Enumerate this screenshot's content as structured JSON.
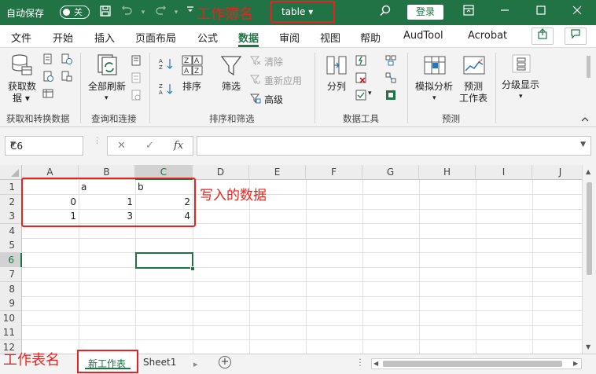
{
  "titlebar": {
    "autosave_label": "自动保存",
    "autosave_state": "关",
    "workbook_name_annotation": "工作簿名",
    "workbook_name": "table ▾",
    "login_label": "登录",
    "icons": [
      "save-icon",
      "undo-icon",
      "redo-icon",
      "customize-icon",
      "search-icon",
      "ribbon-display-icon",
      "minimize-icon",
      "maximize-icon",
      "close-icon"
    ]
  },
  "tabs": {
    "items": [
      "文件",
      "开始",
      "插入",
      "页面布局",
      "公式",
      "数据",
      "审阅",
      "视图",
      "帮助",
      "AudTool",
      "Acrobat"
    ],
    "active": "数据"
  },
  "ribbon": {
    "groups": {
      "get_data": {
        "label": "获取和转换数据",
        "big_label_1": "获取数",
        "big_label_2": "据 ▾"
      },
      "query": {
        "label": "查询和连接",
        "refresh_label_1": "全部刷新",
        "refresh_caret": "▾"
      },
      "sort_filter": {
        "label": "排序和筛选",
        "sort_label": "排序",
        "filter_label": "筛选",
        "clear_label": "清除",
        "reapply_label": "重新应用",
        "advanced_label": "高级"
      },
      "data_tools": {
        "label": "数据工具",
        "split_label": "分列"
      },
      "forecast": {
        "label": "预测",
        "whatif_label_1": "模拟分析",
        "whatif_caret": "▾",
        "forecast_label_1": "预测",
        "forecast_label_2": "工作表"
      },
      "outline": {
        "label": "",
        "outline_label": "分级显示",
        "outline_caret": "▾"
      }
    }
  },
  "formula_bar": {
    "name_box": "C6",
    "cancel_glyph": "✕",
    "enter_glyph": "✓",
    "fx_glyph": "fx",
    "formula": ""
  },
  "grid": {
    "columns": [
      "A",
      "B",
      "C",
      "D",
      "E",
      "F",
      "G",
      "H",
      "I",
      "J"
    ],
    "rows": [
      "1",
      "2",
      "3",
      "4",
      "5",
      "6",
      "7",
      "8",
      "9",
      "10",
      "11",
      "12"
    ],
    "selected_cell": "C6",
    "cells": {
      "B1": "a",
      "C1": "b",
      "A2": "0",
      "B2": "1",
      "C2": "2",
      "A3": "1",
      "B3": "3",
      "C3": "4"
    },
    "data_annotation": "写入的数据"
  },
  "sheets": {
    "annotation": "工作表名",
    "tabs": [
      "新工作表",
      "Sheet1"
    ],
    "active": "新工作表",
    "add_glyph": "+",
    "dots": "⋮"
  },
  "colors": {
    "excel_green": "#217346",
    "annotation_red": "#e8231e"
  }
}
